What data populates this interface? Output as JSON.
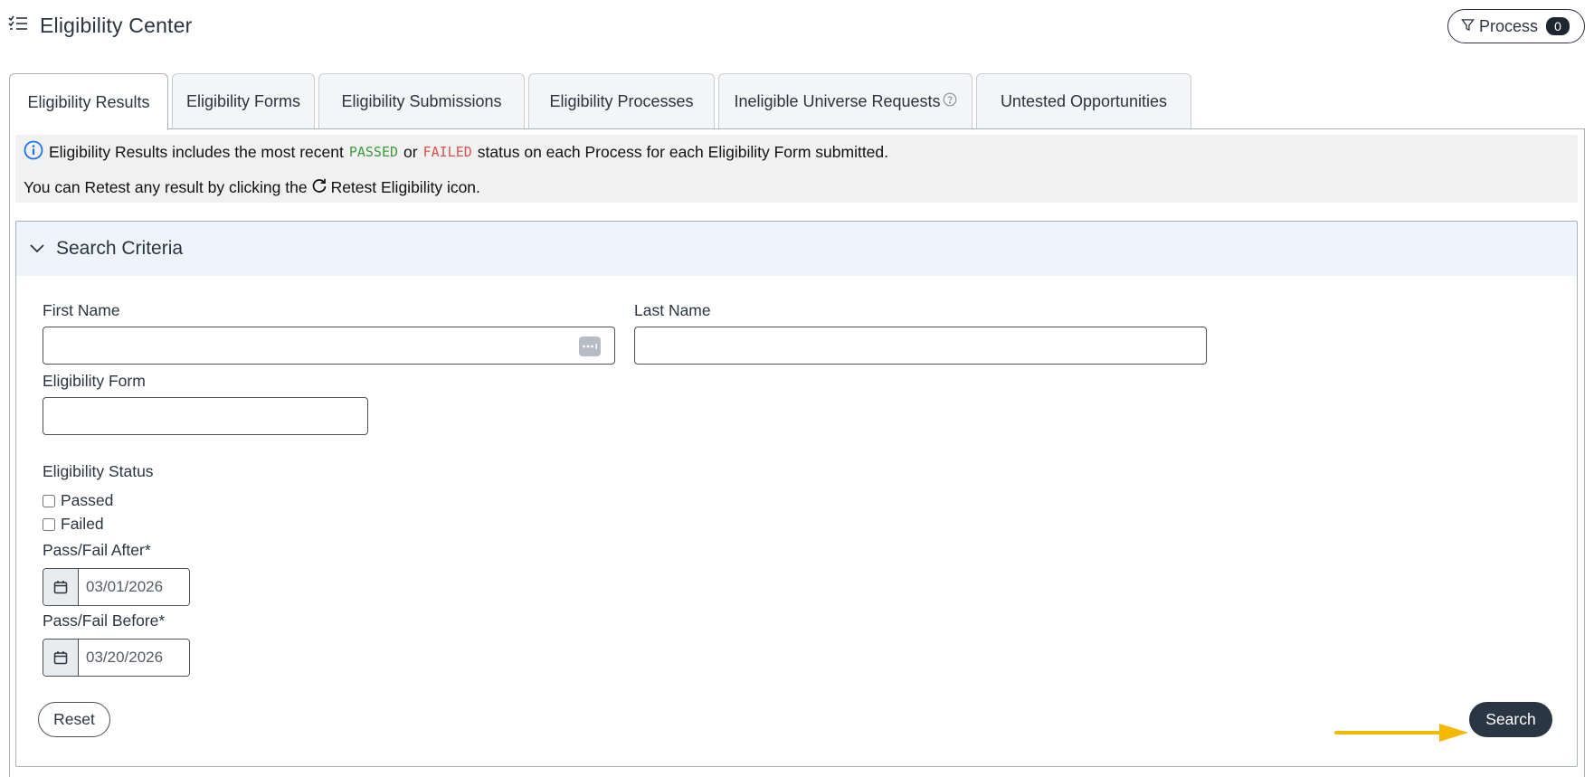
{
  "header": {
    "title": "Eligibility Center",
    "process_label": "Process",
    "process_count": "0"
  },
  "tabs": [
    {
      "label": "Eligibility Results",
      "active": true
    },
    {
      "label": "Eligibility Forms"
    },
    {
      "label": "Eligibility Submissions"
    },
    {
      "label": "Eligibility Processes"
    },
    {
      "label": "Ineligible Universe Requests",
      "has_help_icon": true
    },
    {
      "label": "Untested Opportunities"
    }
  ],
  "info": {
    "line1_prefix": "Eligibility Results includes the most recent",
    "passed_word": "PASSED",
    "or_word": "or",
    "failed_word": "FAILED",
    "line1_suffix": "status on each Process for each Eligibility Form submitted.",
    "line2_prefix": "You can Retest any result by clicking the",
    "line2_suffix": "Retest Eligibility icon."
  },
  "search": {
    "section_title": "Search Criteria",
    "first_name_label": "First Name",
    "first_name_value": "",
    "last_name_label": "Last Name",
    "last_name_value": "",
    "form_label": "Eligibility Form",
    "form_value": "",
    "status_label": "Eligibility Status",
    "passed_option": "Passed",
    "failed_option": "Failed",
    "after_label": "Pass/Fail After*",
    "after_value": "03/01/2026",
    "before_label": "Pass/Fail Before*",
    "before_value": "03/20/2026",
    "reset_label": "Reset",
    "search_label": "Search"
  },
  "colors": {
    "passed": "#3f9a3f",
    "failed": "#d9534f",
    "primary_button": "#2b3644",
    "arrow": "#f5b800",
    "info_icon": "#1e73e8",
    "criteria_header_bg": "#eef4fb"
  },
  "icons": {
    "menu": "list-check-icon",
    "filter": "filter-icon",
    "info": "info-circle-icon",
    "retest": "rotate-right-icon",
    "collapse": "chevron-down-icon",
    "calendar": "calendar-icon",
    "password_manager": "password-dots-icon",
    "help": "question-circle-icon"
  }
}
